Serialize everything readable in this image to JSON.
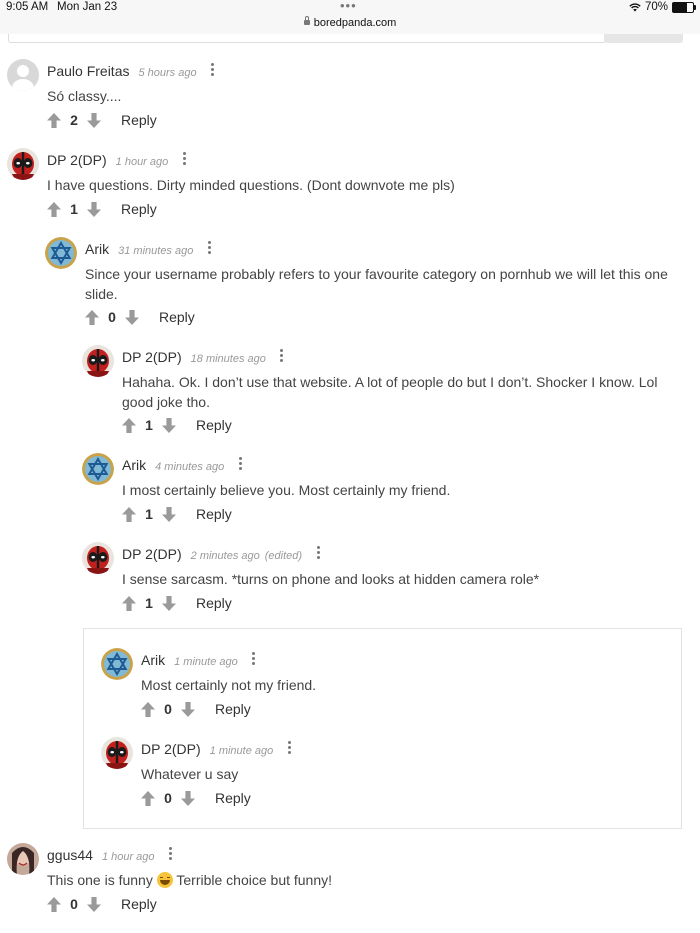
{
  "status_bar": {
    "time": "9:05 AM",
    "date": "Mon Jan 23",
    "dots": "•••",
    "url": "boredpanda.com",
    "battery": "70%",
    "battery_level": 0.7
  },
  "reply_label": "Reply",
  "comments": [
    {
      "name": "Paulo Freitas",
      "time": "5 hours ago",
      "text": "Só classy....",
      "score": "2",
      "avatar": "default-avatar"
    },
    {
      "name": "DP 2(DP)",
      "time": "1 hour ago",
      "text": "I have questions. Dirty minded questions. (Dont downvote me pls)",
      "score": "1",
      "avatar": "deadpool-avatar"
    },
    {
      "name": "Arik",
      "time": "31 minutes ago",
      "text": "Since your username probably refers to your favourite category on pornhub we will let this one slide.",
      "score": "0",
      "avatar": "star-avatar"
    },
    {
      "name": "DP 2(DP)",
      "time": "18 minutes ago",
      "text": "Hahaha. Ok. I don’t use that website. A lot of people do but I don’t. Shocker I know. Lol good joke tho.",
      "score": "1",
      "avatar": "deadpool-avatar"
    },
    {
      "name": "Arik",
      "time": "4 minutes ago",
      "text": "I most certainly believe you. Most certainly my friend.",
      "score": "1",
      "avatar": "star-avatar"
    },
    {
      "name": "DP 2(DP)",
      "time": "2 minutes ago",
      "edited": "(edited)",
      "text": "I sense sarcasm. *turns on phone and looks at hidden camera role*",
      "score": "1",
      "avatar": "deadpool-avatar"
    },
    {
      "name": "Arik",
      "time": "1 minute ago",
      "text": "Most certainly not my friend.",
      "score": "0",
      "avatar": "star-avatar"
    },
    {
      "name": "DP 2(DP)",
      "time": "1 minute ago",
      "text": "Whatever u say",
      "score": "0",
      "avatar": "deadpool-avatar"
    },
    {
      "name": "ggus44",
      "time": "1 hour ago",
      "text_before": "This one is funny",
      "text_after": "Terrible choice but funny!",
      "emoji": "laughing-emoji",
      "score": "0",
      "avatar": "photo-avatar"
    }
  ]
}
